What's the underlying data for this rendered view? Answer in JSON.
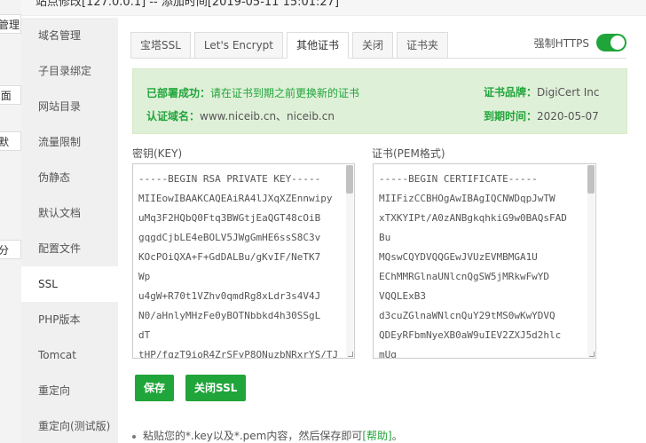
{
  "background": {
    "items": [
      "站管理",
      "ux面",
      "改默",
      "部分"
    ]
  },
  "modal": {
    "title": "站点修改[127.0.0.1] -- 添加时间[2019-05-11 15:01:27]"
  },
  "sidebar": {
    "items": [
      {
        "label": "域名管理"
      },
      {
        "label": "子目录绑定"
      },
      {
        "label": "网站目录"
      },
      {
        "label": "流量限制"
      },
      {
        "label": "伪静态"
      },
      {
        "label": "默认文档"
      },
      {
        "label": "配置文件"
      },
      {
        "label": "SSL"
      },
      {
        "label": "PHP版本"
      },
      {
        "label": "Tomcat"
      },
      {
        "label": "重定向"
      },
      {
        "label": "重定向(测试版)"
      }
    ],
    "active": "SSL"
  },
  "tabs": [
    {
      "label": "宝塔SSL"
    },
    {
      "label": "Let's Encrypt"
    },
    {
      "label": "其他证书"
    },
    {
      "label": "关闭"
    },
    {
      "label": "证书夹"
    }
  ],
  "active_tab": "其他证书",
  "force_https": {
    "label": "强制HTTPS",
    "enabled": true,
    "color": "#20a53a"
  },
  "status": {
    "deployed_key": "已部署成功：",
    "deployed_msg": "请在证书到期之前更换新的证书",
    "domain_key": "认证域名：",
    "domain_val": "www.niceib.cn、niceib.cn",
    "brand_key": "证书品牌：",
    "brand_val": "DigiCert Inc",
    "expiry_key": "到期时间：",
    "expiry_val": "2020-05-07"
  },
  "key_field": {
    "label": "密钥(KEY)",
    "lines": [
      "-----BEGIN RSA PRIVATE KEY-----",
      "MIIEowIBAAKCAQEAiRA4lJXqXZEnnwipy",
      "uMq3F2HQbQ0Ftq3BWGtjEaQGT48cOiB",
      "gqgdCjbLE4eBOLV5JWgGmHE6ssS8C3v",
      "KOcPOiQXA+F+GdDALBu/gKvIF/NeTK7",
      "Wp",
      "u4gW+R70t1VZhv0qmdRg8xLdr3s4V4J",
      "N0/aHnlyMHzFe0yBOTNbbkd4h30SSgL",
      "dT",
      "tHP/fqzT9ioR4ZrSFyP8ONuzbNRxrYS/TJ"
    ]
  },
  "cert_field": {
    "label": "证书(PEM格式)",
    "lines": [
      "-----BEGIN CERTIFICATE-----",
      "MIIFizCCBHOgAwIBAgIQCNWDqpJwTW",
      "xTXKYIPt/A0zANBgkqhkiG9w0BAQsFAD",
      "Bu",
      "MQswCQYDVQQGEwJVUzEVMBMGA1U",
      "EChMMRGlnaUNlcnQgSW5jMRkwFwYD",
      "VQQLExB3",
      "d3cuZGlnaWNlcnQuY29tMS0wKwYDVQ",
      "QDEyRFbmNyeXB0aW9uIEV2ZXJ5d2hlc",
      "mUg"
    ]
  },
  "buttons": {
    "save": "保存",
    "close_ssl": "关闭SSL"
  },
  "tips": {
    "text": "粘贴您的*.key以及*.pem内容，然后保存即可",
    "help": "[帮助]",
    "end": "。"
  },
  "colors": {
    "accent": "#20a53a",
    "status_bg": "#dff0d8"
  }
}
